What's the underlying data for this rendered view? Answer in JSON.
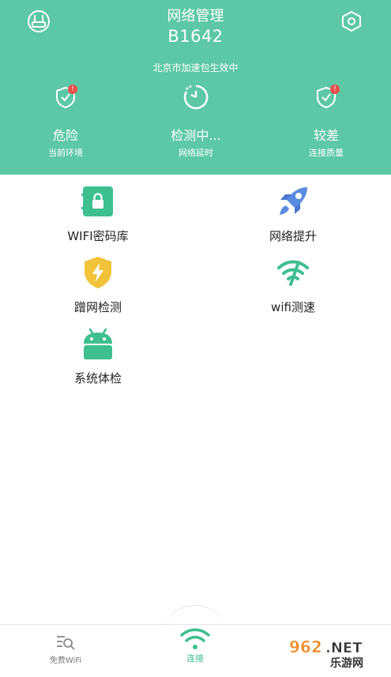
{
  "header": {
    "title": "网络管理",
    "ssid": "B1642",
    "speedup": "北京市加速包生效中",
    "left_icon": "router-icon",
    "right_icon": "settings-hexagon-icon"
  },
  "stats": [
    {
      "value": "危险",
      "label": "当前环境",
      "icon": "shield-alert-icon",
      "badge": "!"
    },
    {
      "value": "检测中...",
      "label": "网络延时",
      "icon": "timer-icon"
    },
    {
      "value": "较差",
      "label": "连接质量",
      "icon": "shield-alert-icon",
      "badge": "!"
    }
  ],
  "features": [
    {
      "label": "WIFI密码库",
      "icon": "wifi-password-lock-icon"
    },
    {
      "label": "网络提升",
      "icon": "rocket-icon"
    },
    {
      "label": "蹭网检测",
      "icon": "shield-bolt-icon"
    },
    {
      "label": "wifi测速",
      "icon": "wifi-speed-icon"
    },
    {
      "label": "系统体检",
      "icon": "android-icon"
    }
  ],
  "tabs": [
    {
      "label": "免费WiFi",
      "icon": "list-search-icon"
    },
    {
      "label": "连接",
      "icon": "wifi-icon"
    }
  ],
  "watermark": "962.NET 乐游网",
  "colors": {
    "header": "#5dc8a5",
    "accent": "#3ebf8f",
    "badge": "#ef4d4d"
  }
}
